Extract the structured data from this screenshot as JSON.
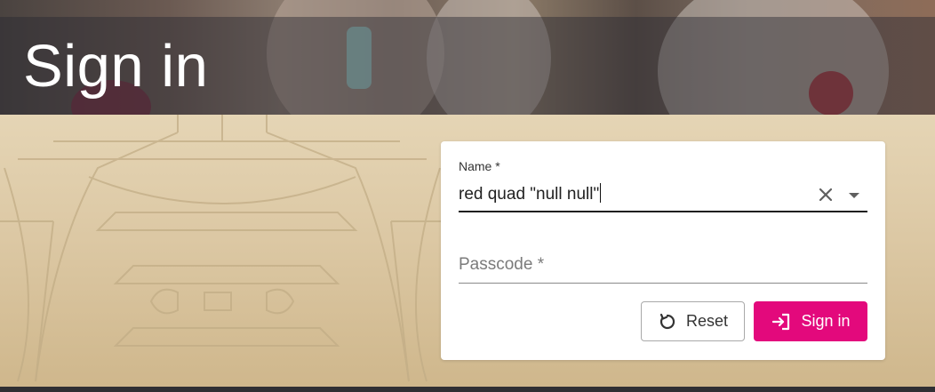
{
  "header": {
    "title": "Sign in"
  },
  "form": {
    "name_field": {
      "label": "Name *",
      "value": "red quad \"null null\""
    },
    "passcode_field": {
      "placeholder": "Passcode *",
      "value": ""
    },
    "reset_label": "Reset",
    "signin_label": "Sign in"
  },
  "colors": {
    "accent": "#e3097c",
    "header_strip": "#3a3a44",
    "backdrop": "#dcc8a4"
  },
  "icons": {
    "clear": "close-icon",
    "dropdown": "caret-down-icon",
    "reset": "refresh-icon",
    "signin": "login-icon"
  }
}
